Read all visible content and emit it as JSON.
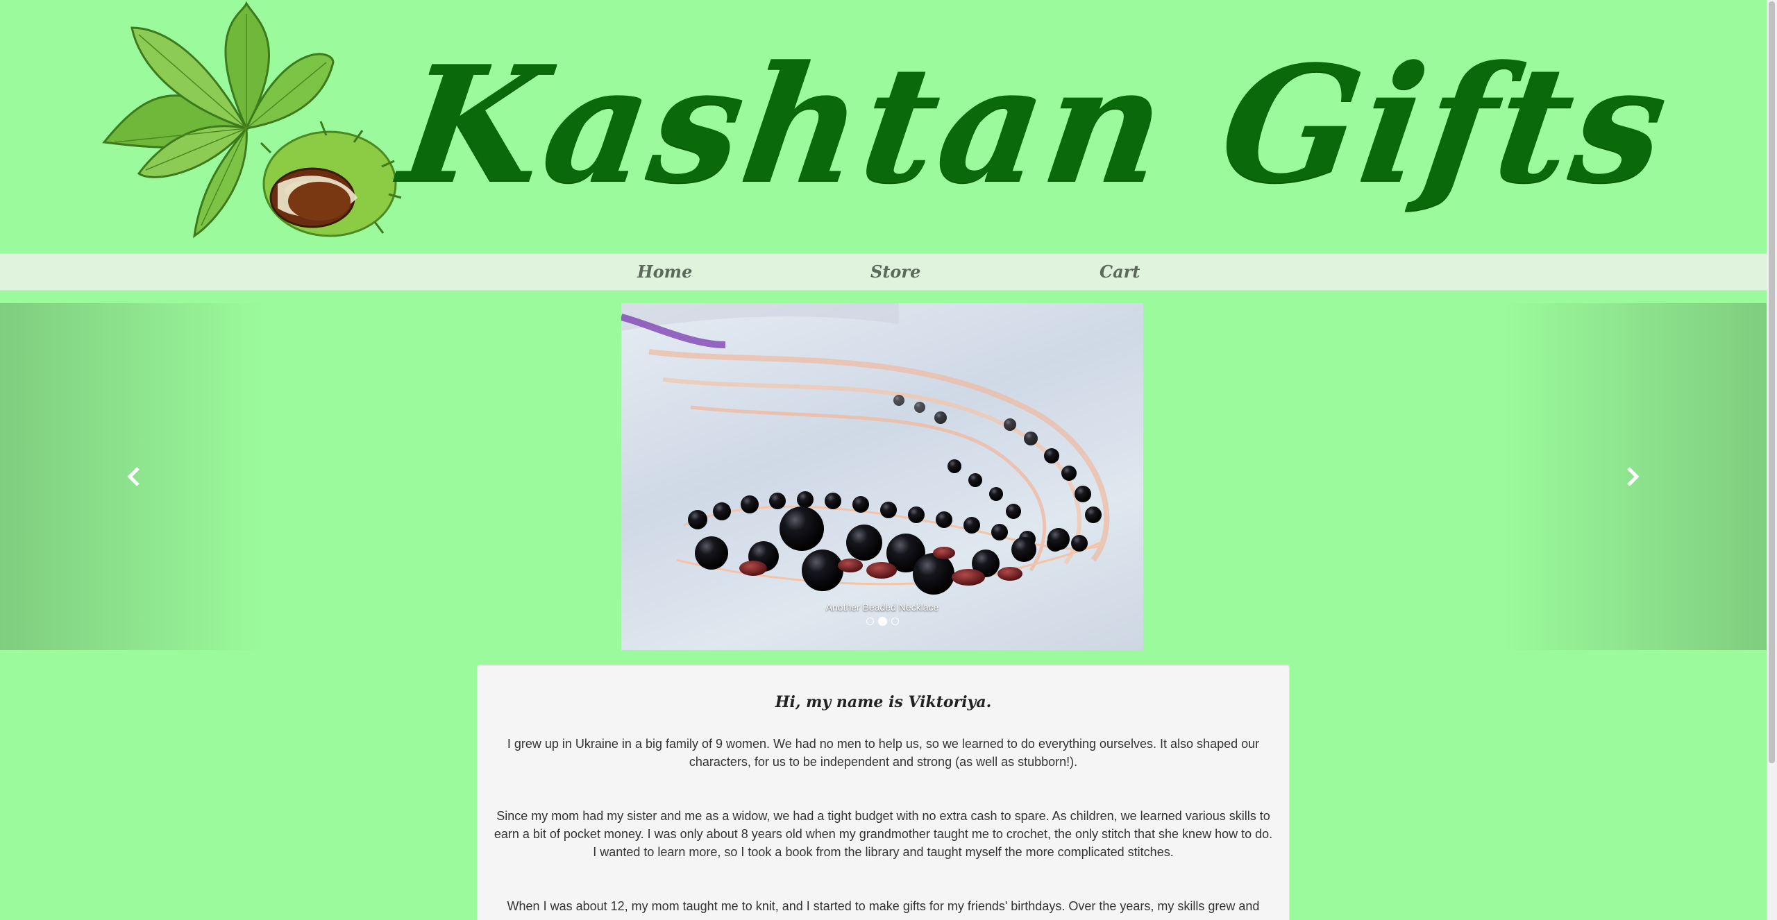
{
  "brand": {
    "name": "Kashtan Gifts",
    "logo_icon": "chestnut-leaf-icon",
    "color": "#0a6a09"
  },
  "nav": {
    "items": [
      {
        "label": "Home"
      },
      {
        "label": "Store"
      },
      {
        "label": "Cart"
      }
    ]
  },
  "carousel": {
    "caption": "Another Beaded Necklace",
    "slide_count": 3,
    "active_index": 1,
    "prev_icon": "chevron-left-icon",
    "next_icon": "chevron-right-icon"
  },
  "about": {
    "title": "Hi, my name is Viktoriya.",
    "paragraphs": [
      "I grew up in Ukraine in a big family of 9 women. We had no men to help us, so we learned to do everything ourselves. It also shaped our characters, for us to be independent and strong (as well as stubborn!).",
      "Since my mom had my sister and me as a widow, we had a tight budget with no extra cash to spare. As children, we learned various skills to earn a bit of pocket money. I was only about 8 years old when my grandmother taught me to crochet, the only stitch that she knew how to do. I wanted to learn more, so I took a book from the library and taught myself the more complicated stitches.",
      "When I was about 12, my mom taught me to knit, and I started to make gifts for my friends' birthdays. Over the years, my skills grew and"
    ]
  },
  "colors": {
    "page_background": "#9bfa9b",
    "nav_background": "#e0f3dc",
    "card_background": "#f5f5f5"
  }
}
